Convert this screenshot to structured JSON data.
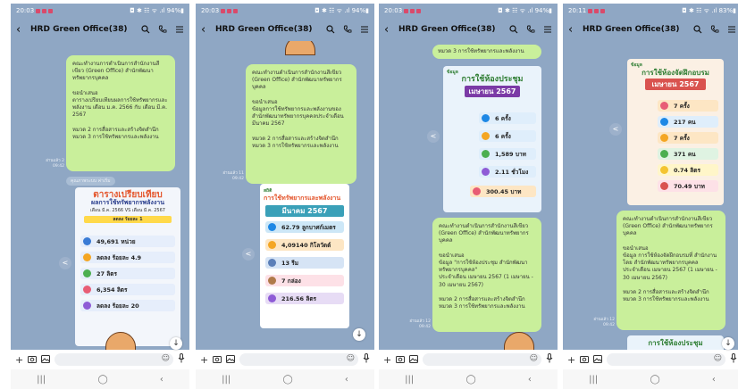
{
  "chat_title": "HRD Green Office(38)",
  "screens": [
    {
      "status_time": "20:03",
      "status_right": "◘ ✱ ☷ ᯤ .ıl 94%▮",
      "message": "คณะทำงานการดำเนินการสำนักงานสีเขียว (Green Office) สำนักพัฒนาทรัพยากรบุคคล\n\nขอนำเสนอ\nตารางเปรียบเทียบผลการใช้ทรัพยากรและพลังงาน เดือน ม.ค. 2566 กับ เดือน มี.ค. 2567\n\nหมวด 2 การสื่อสารและสร้างจิตสำนึก\nหมวด 3 การใช้ทรัพยากรและพลังงาน",
      "msg_time": "อ่านแล้ว 2\n09:42",
      "read_label": "คุณภาพระบบ ค่าเริ่ม",
      "poster": {
        "title": "ตารางเปรียบเทียบ",
        "subtitle": "ผลการใช้ทรัพยากรพลังงาน",
        "period": "เดือน มี.ค. 2566 VS เดือน มี.ค. 2567",
        "summary": "ลดลง ร้อยละ 1",
        "rows": [
          "49,691 หน่วย",
          "ลดลง ร้อยละ 4.9",
          "27 ลิตร",
          "6,354 ลิตร",
          "ลดลง ร้อยละ 20"
        ]
      }
    },
    {
      "status_time": "20:03",
      "status_right": "◘ ✱ ☷ ᯤ .ıl 94%▮",
      "message": "คณะทำงานดำเนินการสำนักงานสีเขียว (Green Office) สำนักพัฒนาทรัพยากรบุคคล\n\nขอนำเสนอ\nข้อมูลการใช้ทรัพยากรและพลังงานของสำนักพัฒนาทรัพยากรบุคคลประจำเดือน มีนาคม 2567\n\nหมวด 2 การสื่อสารและสร้างจิตสำนึก\nหมวด 3 การใช้ทรัพยากรและพลังงาน",
      "msg_time": "อ่านแล้ว 11\n09:42",
      "poster": {
        "title": "สถิติ",
        "subtitle": "การใช้ทรัพยากรและพลังงาน",
        "period": "มีนาคม 2567",
        "rows": [
          "62.79 ลูกบาศก์เมตร",
          "4,09140 กิโลวัตต์",
          "13 รีม",
          "7 กล่อง",
          "216.56 ลิตร"
        ]
      }
    },
    {
      "status_time": "20:03",
      "status_right": "◘ ✱ ☷ ᯤ .ıl 94%▮",
      "top_message": "หมวด 3 การใช้ทรัพยากรและพลังงาน",
      "message": "คณะทำงานดำเนินการสำนักงานสีเขียว (Green Office) สำนักพัฒนาทรัพยากรบุคคล\n\nขอนำเสนอ\nข้อมูล \"การใช้ห้องประชุม สำนักพัฒนาทรัพยากรบุคคล\"\nประจำเดือน เมษายน 2567 (1 เมษายน - 30 เมษายน 2567)\n\nหมวด 2 การสื่อสารและสร้างจิตสำนึก\nหมวด 3 การใช้ทรัพยากรและพลังงาน",
      "msg_time": "อ่านแล้ว 12\n09:42",
      "poster": {
        "title": "การใช้ห้องประชุม",
        "subtitle": "ข้อมูล",
        "period": "เมษายน 2567",
        "rows": [
          "6 ครั้ง",
          "6 ครั้ง",
          "1,589 บาท",
          "2.11 ชั่วโมง",
          "300.45 บาท"
        ]
      }
    },
    {
      "status_time": "20:11",
      "status_right": "◘ ✱ ☷ ᯤ .ıl 83%▮",
      "message": "คณะทำงานดำเนินการสำนักงานสีเขียว (Green Office) สำนักพัฒนาทรัพยากรบุคคล\n\nขอนำเสนอ\nข้อมูล การใช้ห้องจัดฝึกอบรมที่ สำนักงานโดย สำนักพัฒนาทรัพยากรบุคคล\nประจำเดือน เมษายน 2567 (1 เมษายน - 30 เมษายน 2567)\n\nหมวด 2 การสื่อสารและสร้างจิตสำนึก\nหมวด 3 การใช้ทรัพยากรและพลังงาน",
      "msg_time": "อ่านแล้ว 12\n09:42",
      "poster": {
        "title": "การใช้ห้องจัดฝึกอบรม",
        "subtitle": "ข้อมูล",
        "period": "เมษายน 2567",
        "rows": [
          "7 ครั้ง",
          "217 คน",
          "7 ครั้ง",
          "371 คน",
          "0.74 ลิตร",
          "70.49 บาท"
        ]
      },
      "bottom_poster_title": "การใช้ห้องประชุม"
    }
  ],
  "icons": {
    "back": "‹",
    "search": "search-icon",
    "call": "phone-icon",
    "menu": "menu-icon",
    "plus": "+",
    "camera": "camera-icon",
    "gallery": "gallery-icon",
    "emoji": "☺",
    "mic": "mic-icon",
    "share": "<",
    "down": "↓",
    "nav_recent": "|||",
    "nav_home": "◯",
    "nav_back": "‹"
  },
  "colors": {
    "chat_bg": "#8fa7c4",
    "bubble": "#c9ef9b",
    "accent": "#e4572e"
  }
}
